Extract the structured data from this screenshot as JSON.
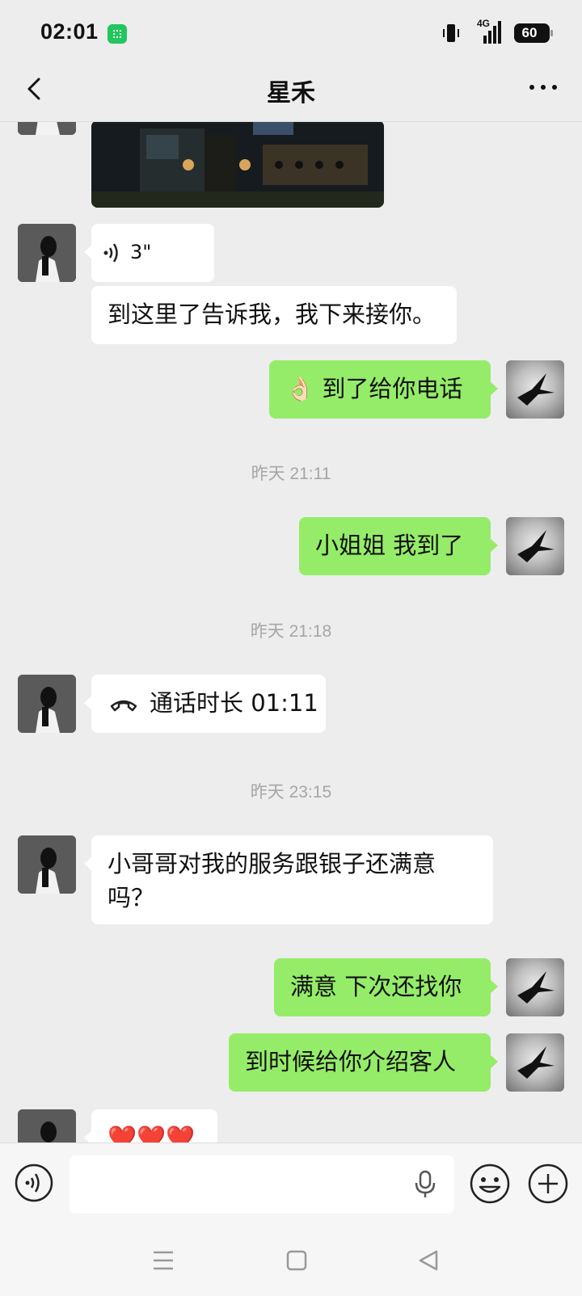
{
  "status_bar": {
    "time": "02:01",
    "network": "4G",
    "battery": "60"
  },
  "header": {
    "title": "星禾"
  },
  "messages": {
    "voice_duration": "3\"",
    "m1_text": "到这里了告诉我，我下来接你。",
    "m2_emoji": "👌🏻",
    "m2_text": "到了给你电话",
    "ts1": "昨天 21:11",
    "m3_text": "小姐姐 我到了",
    "ts2": "昨天 21:18",
    "m4_call_text": "通话时长 01:11",
    "ts3": "昨天 23:15",
    "m5_text": "小哥哥对我的服务跟银子还满意吗？",
    "m6_text": "满意 下次还找你",
    "m7_text": "到时候给你介绍客人",
    "m8_text": "❤️❤️❤️"
  },
  "input": {
    "placeholder": ""
  },
  "colors": {
    "bubble_self": "#95ec69",
    "bubble_other": "#ffffff",
    "background": "#ededed"
  }
}
